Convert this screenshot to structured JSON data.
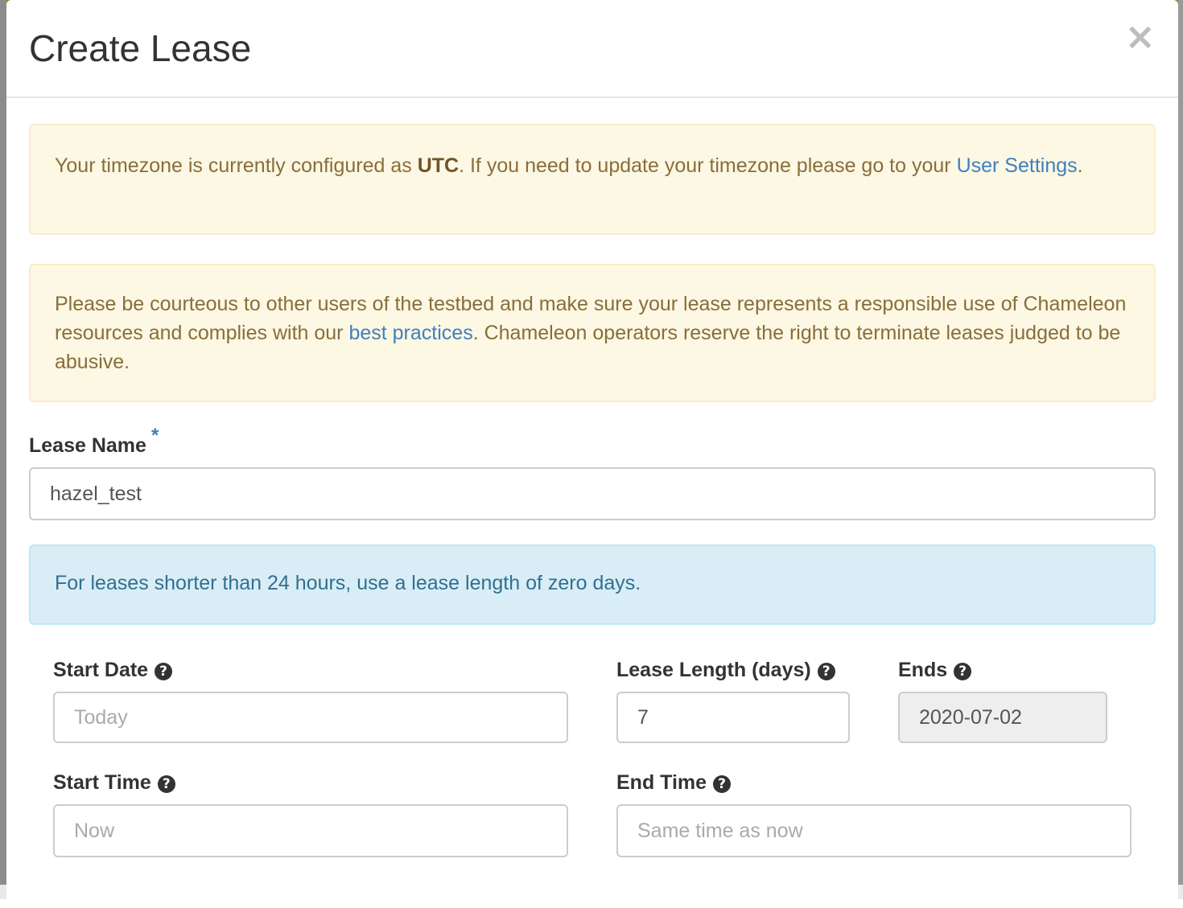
{
  "modal": {
    "title": "Create Lease",
    "close_symbol": "×"
  },
  "alerts": {
    "timezone": {
      "prefix": "Your timezone is currently configured as ",
      "timezone": "UTC",
      "middle": ". If you need to update your timezone please go to your ",
      "link": "User Settings",
      "suffix": "."
    },
    "courtesy": {
      "prefix": "Please be courteous to other users of the testbed and make sure your lease represents a responsible use of Chameleon resources and complies with our ",
      "link": "best practices",
      "suffix": ". Chameleon operators reserve the right to terminate leases judged to be abusive."
    },
    "short_lease": "For leases shorter than 24 hours, use a lease length of zero days."
  },
  "form": {
    "lease_name": {
      "label": "Lease Name",
      "required_mark": "*",
      "value": "hazel_test"
    },
    "start_date": {
      "label": "Start Date",
      "placeholder": "Today",
      "value": ""
    },
    "lease_length": {
      "label": "Lease Length (days)",
      "value": "7"
    },
    "ends": {
      "label": "Ends",
      "value": "2020-07-02"
    },
    "start_time": {
      "label": "Start Time",
      "placeholder": "Now",
      "value": ""
    },
    "end_time": {
      "label": "End Time",
      "placeholder": "Same time as now",
      "value": ""
    },
    "help_symbol": "?"
  },
  "colors": {
    "warning_bg": "#fcf8e3",
    "info_bg": "#d9edf7",
    "link": "#3f7fc0",
    "backdrop_green": "#6a9a34"
  }
}
